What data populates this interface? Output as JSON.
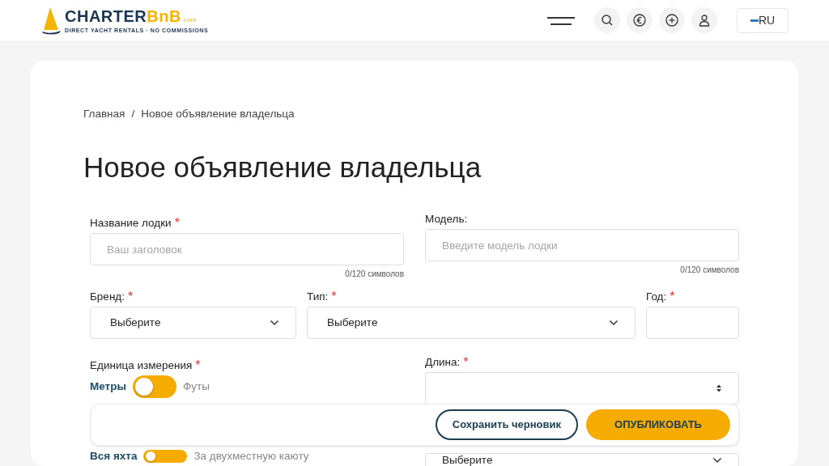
{
  "header": {
    "logo": {
      "name_main": "CHARTER",
      "name_accent": "BnB",
      "domain": ".com",
      "tagline": "DIRECT YACHT RENTALS · NO COMMISSIONS"
    },
    "language": "RU"
  },
  "breadcrumb": [
    {
      "label": "Главная"
    },
    {
      "label": "Новое объявление владельца"
    }
  ],
  "breadcrumb_separator": "/",
  "title": "Новое объявление владельца",
  "required_mark": "*",
  "rows": [
    [
      {
        "kind": "text",
        "label": "Название лодки",
        "required": true,
        "placeholder": "Ваш заголовок",
        "counter": "0/120 символов"
      },
      {
        "kind": "text",
        "label": "Модель:",
        "required": false,
        "placeholder": "Введите модель лодки",
        "counter": "0/120 символов"
      }
    ],
    [
      {
        "kind": "select",
        "label": "Бренд:",
        "required": true,
        "value": "Выберите"
      },
      {
        "kind": "select",
        "label": "Тип:",
        "required": true,
        "value": "Выберите"
      },
      {
        "kind": "input",
        "label": "Год:",
        "required": true
      }
    ],
    [
      {
        "kind": "toggle",
        "label": "Единица измерения",
        "required": true,
        "left": "Метры",
        "right": "Футы",
        "on": false
      },
      {
        "kind": "number",
        "label": "Длина:",
        "required": true
      }
    ],
    [
      {
        "kind": "toggle",
        "left": "Вся яхта",
        "right": "За двухместную каюту",
        "on": false
      },
      {
        "kind": "select",
        "value": "Выберите"
      }
    ]
  ],
  "actions": {
    "secondary": "Сохранить черновик",
    "primary": "ОПУБЛИКОВАТЬ"
  }
}
